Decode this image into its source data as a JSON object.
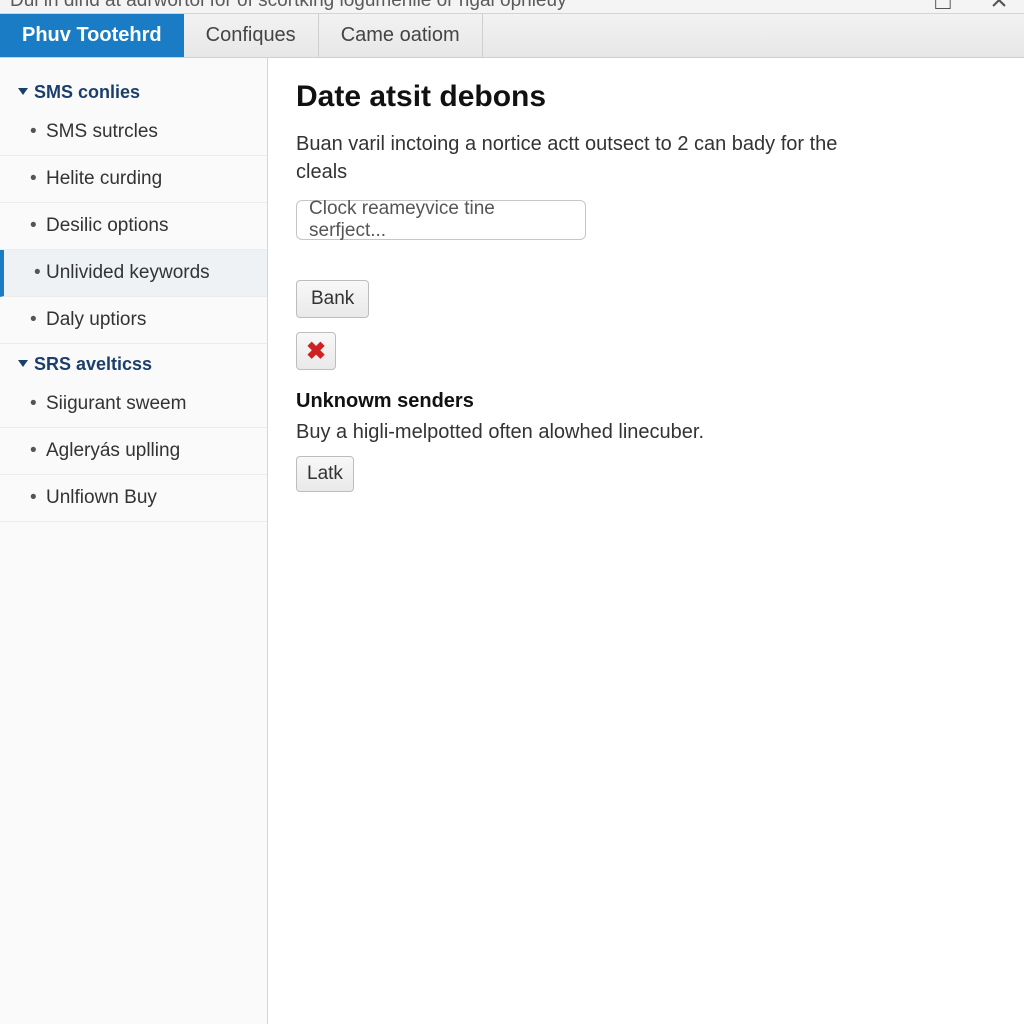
{
  "titlebar": {
    "text": "Dui in dind at adrwortol for of scortking logumenile or rigal opnieuy"
  },
  "tabs": [
    {
      "label": "Phuv Tootehrd",
      "active": true
    },
    {
      "label": "Confiques",
      "active": false
    },
    {
      "label": "Came oatiom",
      "active": false
    }
  ],
  "sidebar": {
    "groups": [
      {
        "title": "SMS conlies",
        "items": [
          {
            "label": "SMS sutrcles",
            "selected": false
          },
          {
            "label": "Helite curding",
            "selected": false
          },
          {
            "label": "Desilic options",
            "selected": false
          },
          {
            "label": "Unlivided keywords",
            "selected": true
          },
          {
            "label": "Daly uptiors",
            "selected": false
          }
        ]
      },
      {
        "title": "SRS avelticss",
        "items": [
          {
            "label": "Siigurant sweem",
            "selected": false
          },
          {
            "label": "Agleryás uplling",
            "selected": false
          },
          {
            "label": "Unlfiown Buy",
            "selected": false
          }
        ]
      }
    ]
  },
  "main": {
    "heading": "Date atsit debons",
    "description": "Buan varil inctoing a nortice actt outsect to 2 can bady for the cleals",
    "textbox_value": "Clock reameyvice tine serfject...",
    "bank_button": "Bank",
    "unknown_section": {
      "title": "Unknowm senders",
      "desc": "Buy a higli-melpotted often alowhed linecuber.",
      "button": "Latk"
    }
  }
}
